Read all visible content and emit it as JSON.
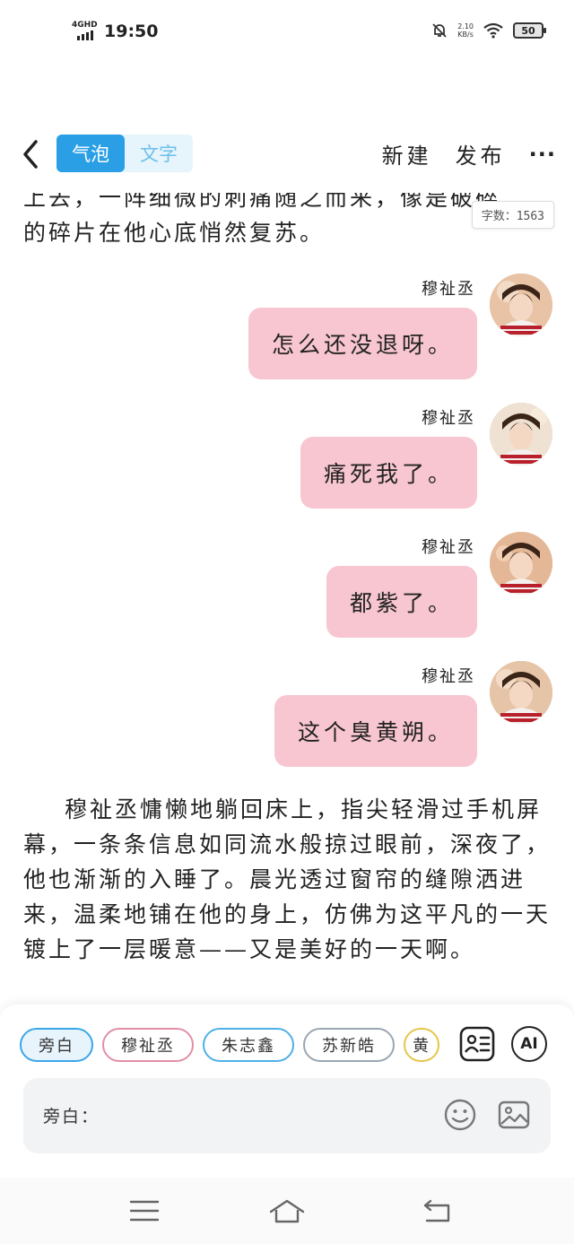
{
  "status_bar": {
    "network": "4GHD",
    "time": "19:50",
    "speed_value": "2.10",
    "speed_unit": "KB/s",
    "battery": "50",
    "icons": [
      "signal-icon",
      "mute-bell-icon",
      "wifi-icon",
      "battery-icon"
    ]
  },
  "toolbar": {
    "back_icon": "chevron-left-icon",
    "mode_tabs": [
      {
        "label": "气泡",
        "active": true
      },
      {
        "label": "文字",
        "active": false
      }
    ],
    "new_label": "新建",
    "publish_label": "发布",
    "more_icon": "more-dots-icon"
  },
  "content": {
    "top_paragraph_line1": "上去，一阵细微的刺痛随之而来，像是破碎",
    "top_paragraph_line2": "的碎片在他心底悄然复苏。",
    "word_count": "字数：1563",
    "messages": [
      {
        "speaker": "穆祉丞",
        "text": "怎么还没退呀。"
      },
      {
        "speaker": "穆祉丞",
        "text": "痛死我了。"
      },
      {
        "speaker": "穆祉丞",
        "text": "都紫了。"
      },
      {
        "speaker": "穆祉丞",
        "text": "这个臭黄朔。"
      }
    ],
    "bottom_paragraph": "穆祉丞慵懒地躺回床上，指尖轻滑过手机屏幕，一条条信息如同流水般掠过眼前，深夜了，他也渐渐的入睡了。晨光透过窗帘的缝隙洒进来，温柔地铺在他的身上，仿佛为这平凡的一天镀上了一层暖意——又是美好的一天啊。"
  },
  "bottom_panel": {
    "characters": [
      "旁白",
      "穆祉丞",
      "朱志鑫",
      "苏新皓",
      "黄"
    ],
    "card_icon": "contact-card-icon",
    "ai_label": "AI",
    "input_label": "旁白：",
    "emoji_icon": "smiley-icon",
    "image_icon": "image-icon"
  },
  "nav_bar": {
    "icons": [
      "menu-icon",
      "home-icon",
      "back-icon"
    ]
  },
  "colors": {
    "accent_blue": "#2a9fe6",
    "bubble_pink": "#f8c6d0",
    "tab_bg": "#e6f4fc"
  }
}
